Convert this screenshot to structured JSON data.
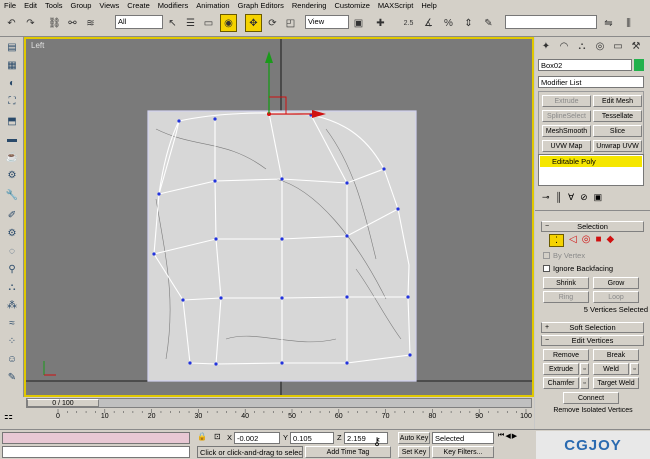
{
  "menu": [
    "File",
    "Edit",
    "Tools",
    "Group",
    "Views",
    "Create",
    "Modifiers",
    "Animation",
    "Graph Editors",
    "Rendering",
    "Customize",
    "MAXScript",
    "Help"
  ],
  "toolbar": {
    "filter_value": "All",
    "ref_coord_value": "View",
    "snap_label": "2.5",
    "percent_label": "%",
    "named_sel_value": ""
  },
  "viewport": {
    "label": "Left",
    "status": "5 Vertices Selected"
  },
  "panel": {
    "object_name": "Box02",
    "object_color": "#22b14c",
    "modifier_list": "Modifier List",
    "mod_buttons": [
      {
        "label": "Extrude",
        "enabled": false
      },
      {
        "label": "Edit Mesh",
        "enabled": true
      },
      {
        "label": "SplineSelect",
        "enabled": false
      },
      {
        "label": "Tessellate",
        "enabled": true
      },
      {
        "label": "MeshSmooth",
        "enabled": true
      },
      {
        "label": "Slice",
        "enabled": true
      },
      {
        "label": "UVW Map",
        "enabled": true
      },
      {
        "label": "Unwrap UVW",
        "enabled": true
      }
    ],
    "stack_item": "Editable Poly",
    "selection": {
      "title": "Selection",
      "by_vertex": "By Vertex",
      "ignore_backfacing": "Ignore Backfacing",
      "shrink": "Shrink",
      "grow": "Grow",
      "ring": "Ring",
      "loop": "Loop",
      "status": "5 Vertices Selected"
    },
    "soft_selection": "Soft Selection",
    "edit_vertices": {
      "title": "Edit Vertices",
      "remove": "Remove",
      "break": "Break",
      "extrude": "Extrude",
      "weld": "Weld",
      "chamfer": "Chamfer",
      "target_weld": "Target Weld",
      "connect": "Connect",
      "remove_isolated": "Remove Isolated Vertices"
    }
  },
  "timeline": {
    "slider_text": "0 / 100",
    "ticks": [
      "0",
      "10",
      "20",
      "30",
      "40",
      "50",
      "60",
      "70",
      "80",
      "90",
      "100"
    ]
  },
  "status": {
    "x_label": "X",
    "x_value": "-0.002",
    "y_label": "Y",
    "y_value": "0.105",
    "z_label": "Z",
    "z_value": "2.159",
    "prompt": "Click or click-and-drag to select obj",
    "add_time_tag": "Add Time Tag",
    "auto_key": "Auto Key",
    "set_key": "Set Key",
    "selected": "Selected",
    "key_filters": "Key Filters..."
  },
  "watermark": "CGJOY"
}
